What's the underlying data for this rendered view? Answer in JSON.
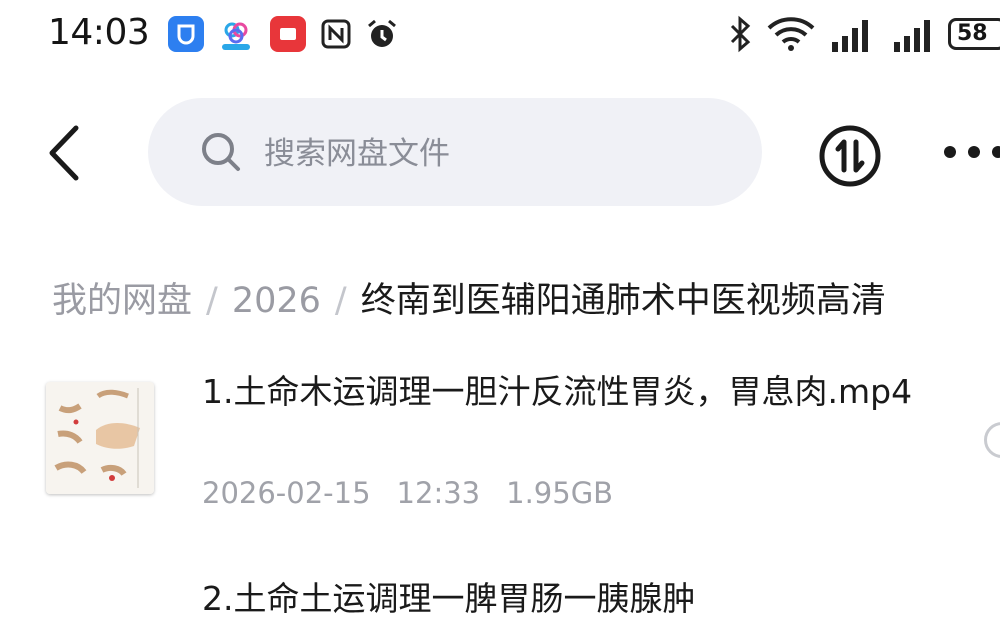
{
  "status_bar": {
    "time": "14:03",
    "app_icons": [
      "shield-app-icon",
      "seaflow-app-icon",
      "red-app-icon",
      "nfc-icon",
      "alarm-icon"
    ],
    "battery": "58"
  },
  "header": {
    "search_placeholder": "搜索网盘文件"
  },
  "breadcrumb": {
    "items": [
      "我的网盘",
      "2026",
      "终南到医辅阳通肺术中医视频高清"
    ],
    "separator": "/"
  },
  "files": [
    {
      "name": "1.土命木运调理一胆汁反流性胃炎，胃息肉.mp4",
      "date": "2026-02-15",
      "time": "12:33",
      "size": "1.95GB"
    },
    {
      "name": "2.土命土运调理一脾胃肠一胰腺肿"
    }
  ],
  "colors": {
    "search_bg": "#f0f1f6",
    "muted_text": "#9a9ba3",
    "primary_text": "#1a1a1a"
  }
}
